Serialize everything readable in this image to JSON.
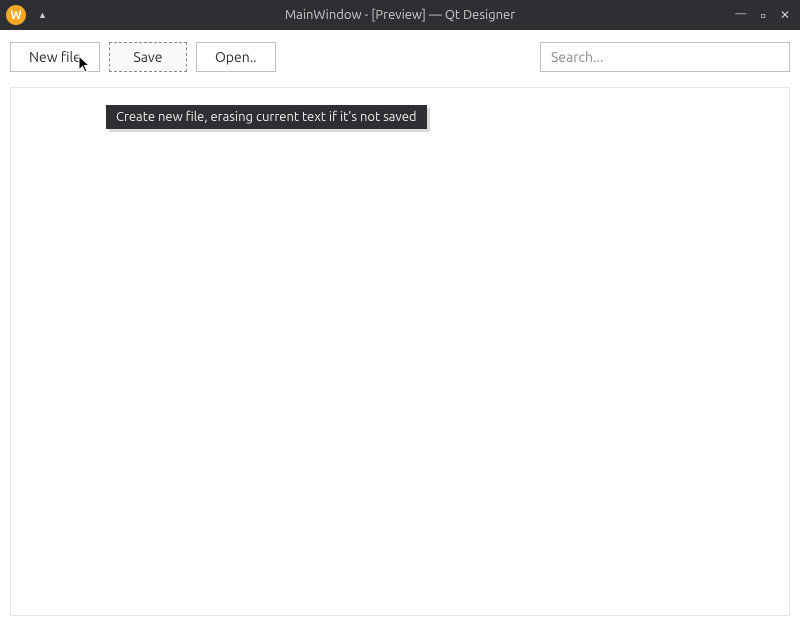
{
  "titlebar": {
    "app_icon_letter": "W",
    "title": "MainWindow - [Preview] — Qt Designer"
  },
  "toolbar": {
    "new_file_label": "New file",
    "save_label": "Save",
    "open_label": "Open..",
    "search_placeholder": "Search..."
  },
  "tooltip": {
    "text": "Create new file, erasing current text if it's not saved"
  }
}
